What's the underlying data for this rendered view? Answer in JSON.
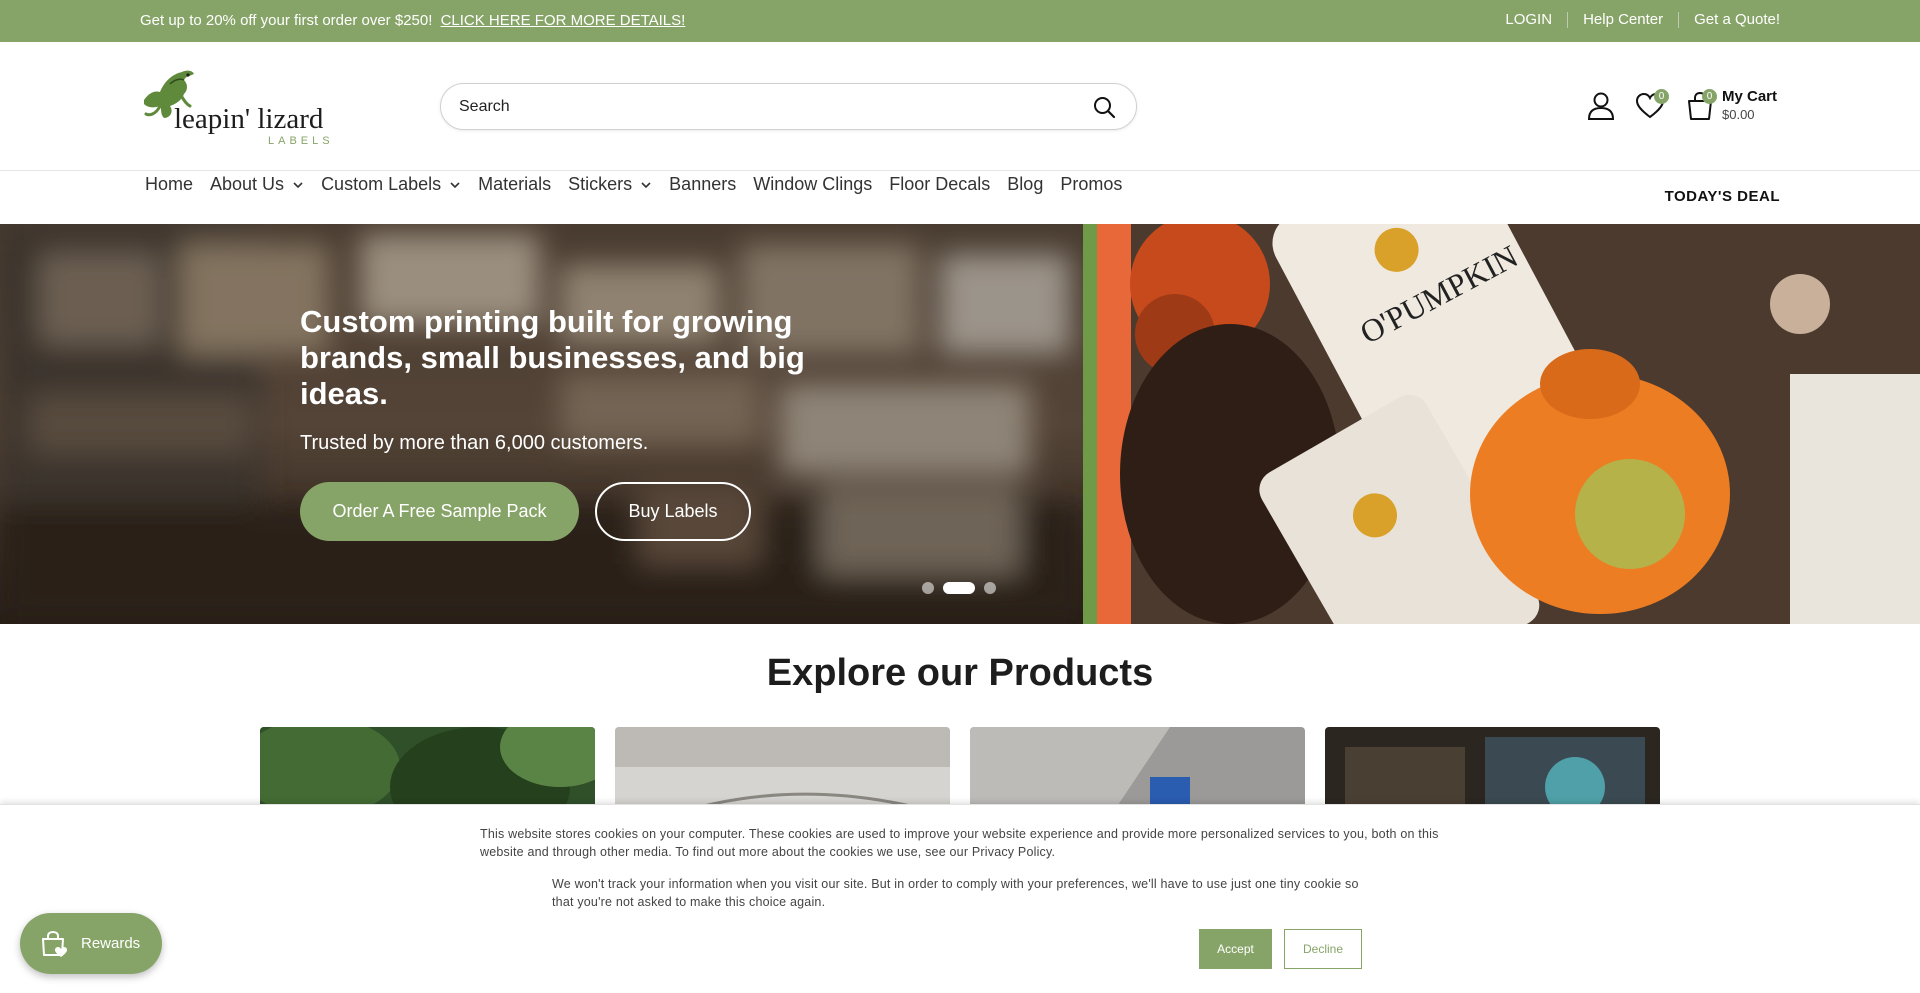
{
  "announcement": {
    "promo_text": "Get up to 20% off your first order over $250!",
    "promo_link": "CLICK HERE FOR MORE DETAILS!",
    "links": [
      "LOGIN",
      "Help Center",
      "Get a Quote!"
    ]
  },
  "brand": {
    "name_line1": "leapin' lizard",
    "name_line2": "LABELS",
    "accent_color": "#87a468"
  },
  "search": {
    "placeholder": "Search",
    "icon": "search-icon"
  },
  "header_icons": {
    "account": "user-icon",
    "wishlist": "heart-icon",
    "wishlist_count": "0",
    "cart": "shopping-bag-icon",
    "cart_count": "0",
    "cart_label": "My Cart",
    "cart_total": "$0.00"
  },
  "nav": {
    "items": [
      {
        "label": "Home"
      },
      {
        "label": "About Us"
      },
      {
        "label": "Custom Labels"
      },
      {
        "label": "Materials"
      },
      {
        "label": "Stickers"
      },
      {
        "label": "Banners"
      },
      {
        "label": "Window Clings"
      },
      {
        "label": "Floor Decals"
      },
      {
        "label": "Blog"
      },
      {
        "label": "Promos"
      }
    ],
    "deal_label": "TODAY'S DEAL"
  },
  "hero": {
    "headline": "Custom printing built for growing brands, small businesses, and big ideas.",
    "subtext": "Trusted by more than 6,000 customers.",
    "primary_button": "Order A Free Sample Pack",
    "secondary_button": "Buy Labels",
    "image_text": "O'PUMPKIN",
    "slides_total": 3,
    "active_slide": 2
  },
  "products": {
    "title": "Explore our Products"
  },
  "cookie": {
    "text1": "This website stores cookies on your computer. These cookies are used to improve your website experience and provide more personalized services to you, both on this website and through other media. To find out more about the cookies we use, see our Privacy Policy.",
    "text2": "We won't track your information when you visit our site. But in order to comply with your preferences, we'll have to use just one tiny cookie so that you're not asked to make this choice again.",
    "accept": "Accept",
    "decline": "Decline"
  },
  "rewards": {
    "label": "Rewards",
    "icon": "rewards-bag-icon"
  }
}
